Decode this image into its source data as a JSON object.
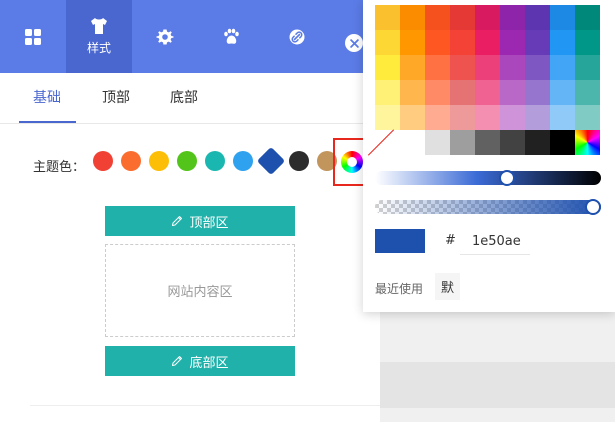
{
  "toolbar": {
    "items": [
      {
        "name": "layout",
        "icon": "grid-icon",
        "label": ""
      },
      {
        "name": "style",
        "icon": "shirt-icon",
        "label": "样式"
      },
      {
        "name": "settings",
        "icon": "gear-icon",
        "label": ""
      },
      {
        "name": "pets",
        "icon": "paw-icon",
        "label": ""
      },
      {
        "name": "link",
        "icon": "link-icon",
        "label": ""
      }
    ],
    "close_icon": "close-icon",
    "accent": "#5b7be6",
    "active_bg": "#4a67cf"
  },
  "tabs": [
    {
      "label": "基础",
      "active": true
    },
    {
      "label": "顶部",
      "active": false
    },
    {
      "label": "底部",
      "active": false
    }
  ],
  "theme": {
    "label": "主题色：",
    "swatches": [
      "#f04134",
      "#fb6d2f",
      "#fdbe07",
      "#52c41a",
      "#1ab7b0",
      "#2ea2ee",
      "#1e50ae",
      "#2c2c2c",
      "#c1955c"
    ],
    "selected_index": 6,
    "picker_icon": "color-wheel-icon"
  },
  "preview": {
    "header_label": "顶部区",
    "content_label": "网站内容区",
    "footer_label": "底部区",
    "bar_color": "#20b2aa",
    "edit_icon": "pencil-icon"
  },
  "picker": {
    "palette": [
      [
        "#fbc02d",
        "#fb8c00",
        "#f4511e",
        "#e53935",
        "#d81b60",
        "#8e24aa",
        "#5e35b1",
        "#1e88e5",
        "#00897b",
        "#43a047"
      ],
      [
        "#fdd835",
        "#ff9800",
        "#ff5722",
        "#f44336",
        "#e91e63",
        "#9c27b0",
        "#673ab7",
        "#2196f3",
        "#009688",
        "#4caf50"
      ],
      [
        "#ffeb3b",
        "#ffa726",
        "#ff7043",
        "#ef5350",
        "#ec407a",
        "#ab47bc",
        "#7e57c2",
        "#42a5f5",
        "#26a69a",
        "#66bb6a"
      ],
      [
        "#fff176",
        "#ffb74d",
        "#ff8a65",
        "#e57373",
        "#f06292",
        "#ba68c8",
        "#9575cd",
        "#64b5f6",
        "#4db6ac",
        "#81c784"
      ],
      [
        "#fff59d",
        "#ffcc80",
        "#ffab91",
        "#ef9a9a",
        "#f48fb1",
        "#ce93d8",
        "#b39ddb",
        "#90caf9",
        "#80cbc4",
        "#a5d6a7"
      ],
      [
        "transparent",
        "#ffffff",
        "#e0e0e0",
        "#9e9e9e",
        "#616161",
        "#424242",
        "#212121",
        "#000000",
        "rainbow"
      ]
    ],
    "hue_position": 0.59,
    "alpha_position": 1.0,
    "current_color": "#1e50ae",
    "hash": "#",
    "hex_value": "1e50ae",
    "recent_label": "最近使用",
    "recent_item": "默"
  }
}
